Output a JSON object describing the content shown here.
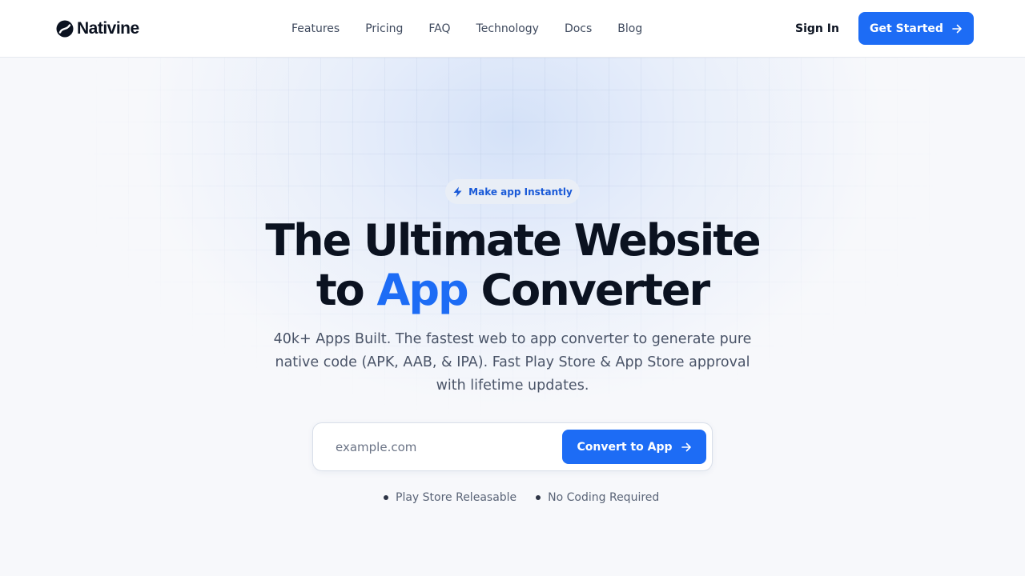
{
  "header": {
    "brand": "Nativine",
    "nav": [
      "Features",
      "Pricing",
      "FAQ",
      "Technology",
      "Docs",
      "Blog"
    ],
    "sign_in": "Sign In",
    "cta": "Get Started"
  },
  "hero": {
    "badge": "Make app Instantly",
    "title_line1": "The Ultimate Website",
    "title_to": "to",
    "title_accent": "App",
    "title_end": "Converter",
    "subtitle": "40k+ Apps Built. The fastest web to app converter to generate pure native code (APK, AAB, & IPA). Fast Play Store & App Store approval with lifetime updates.",
    "url_placeholder": "example.com",
    "convert_button": "Convert to App",
    "features": [
      "Play Store Releasable",
      "No Coding Required"
    ]
  },
  "colors": {
    "accent": "#1d6cf5",
    "text": "#0b1220",
    "muted": "#4a5468",
    "badge_bg": "#e9eef6"
  },
  "icons": {
    "logo": "leaf-swirl-icon",
    "cta_arrow": "arrow-right-icon",
    "badge": "lightning-bolt-icon",
    "bullet": "dot-icon"
  }
}
